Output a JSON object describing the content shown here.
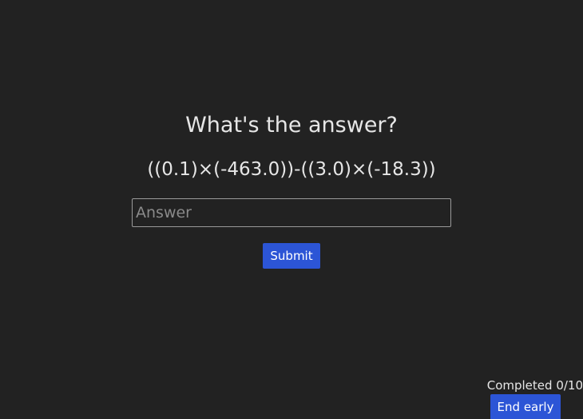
{
  "quiz": {
    "question": "What's the answer?",
    "expression": "((0.1)×(-463.0))-((3.0)×(-18.3))",
    "answer_placeholder": "Answer",
    "answer_value": "",
    "submit_label": "Submit"
  },
  "progress": {
    "text": "Completed 0/10",
    "completed": 0,
    "total": 10
  },
  "actions": {
    "end_early_label": "End early"
  },
  "colors": {
    "background": "#222222",
    "text": "#e6e6e6",
    "button": "#2c55d6",
    "input_border": "#9a9a9a"
  }
}
